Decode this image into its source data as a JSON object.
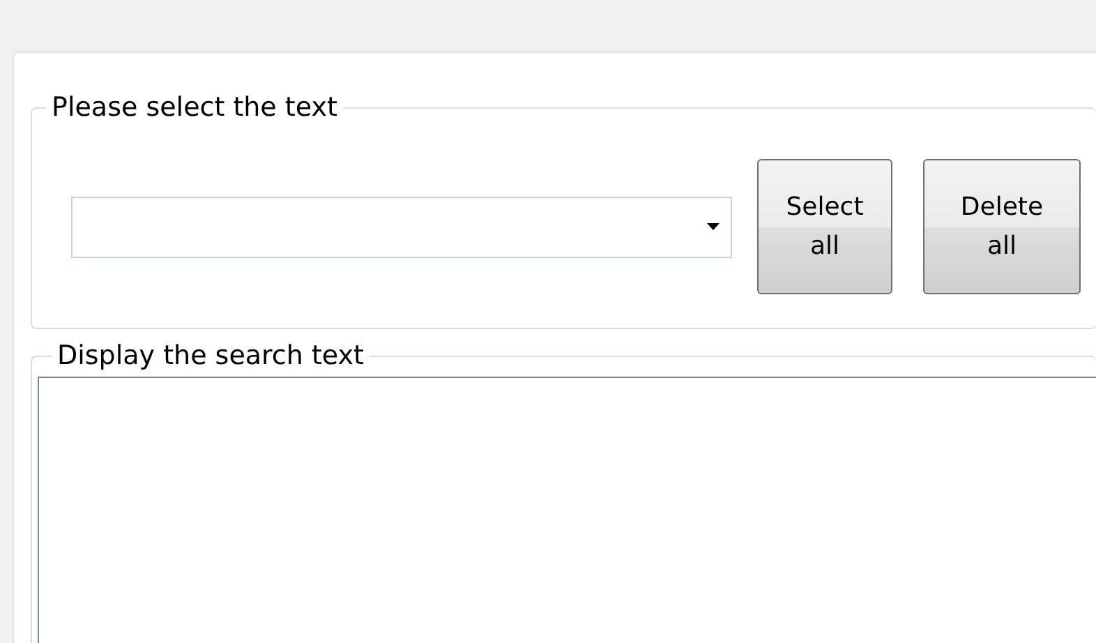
{
  "select_group": {
    "legend": "Please select the text",
    "buttons": [
      {
        "label": "Select all"
      },
      {
        "label": "Delete all"
      }
    ]
  },
  "display_group": {
    "legend": "Display the search text"
  }
}
